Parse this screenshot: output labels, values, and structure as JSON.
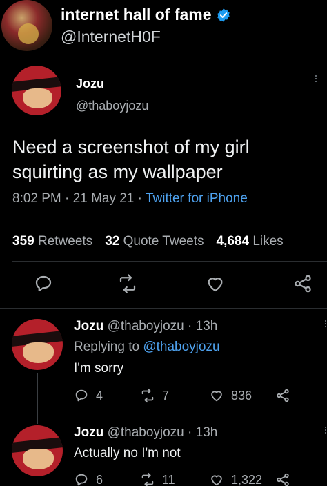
{
  "header": {
    "name": "internet hall of fame",
    "handle": "@InternetH0F"
  },
  "tweet": {
    "author_name": "Jozu",
    "author_handle": "@thaboyjozu",
    "text": "Need a screenshot of my girl squirting as my wallpaper",
    "time": "8:02 PM",
    "date": "21 May 21",
    "source": "Twitter for iPhone",
    "stats": {
      "retweets_count": "359",
      "retweets_label": "Retweets",
      "quotes_count": "32",
      "quotes_label": "Quote Tweets",
      "likes_count": "4,684",
      "likes_label": "Likes"
    }
  },
  "replies": [
    {
      "author_name": "Jozu",
      "author_handle": "@thaboyjozu",
      "age": "13h",
      "replying_to_label": "Replying to",
      "replying_to_handle": "@thaboyjozu",
      "text": "I'm sorry",
      "reply_count": "4",
      "retweet_count": "7",
      "like_count": "836"
    },
    {
      "author_name": "Jozu",
      "author_handle": "@thaboyjozu",
      "age": "13h",
      "text": "Actually no I'm not",
      "reply_count": "6",
      "retweet_count": "11",
      "like_count": "1,322"
    }
  ],
  "colors": {
    "background": "#000000",
    "link": "#4ea2ef",
    "secondary_text": "#a9adb1",
    "verified": "#1d9bf0"
  }
}
